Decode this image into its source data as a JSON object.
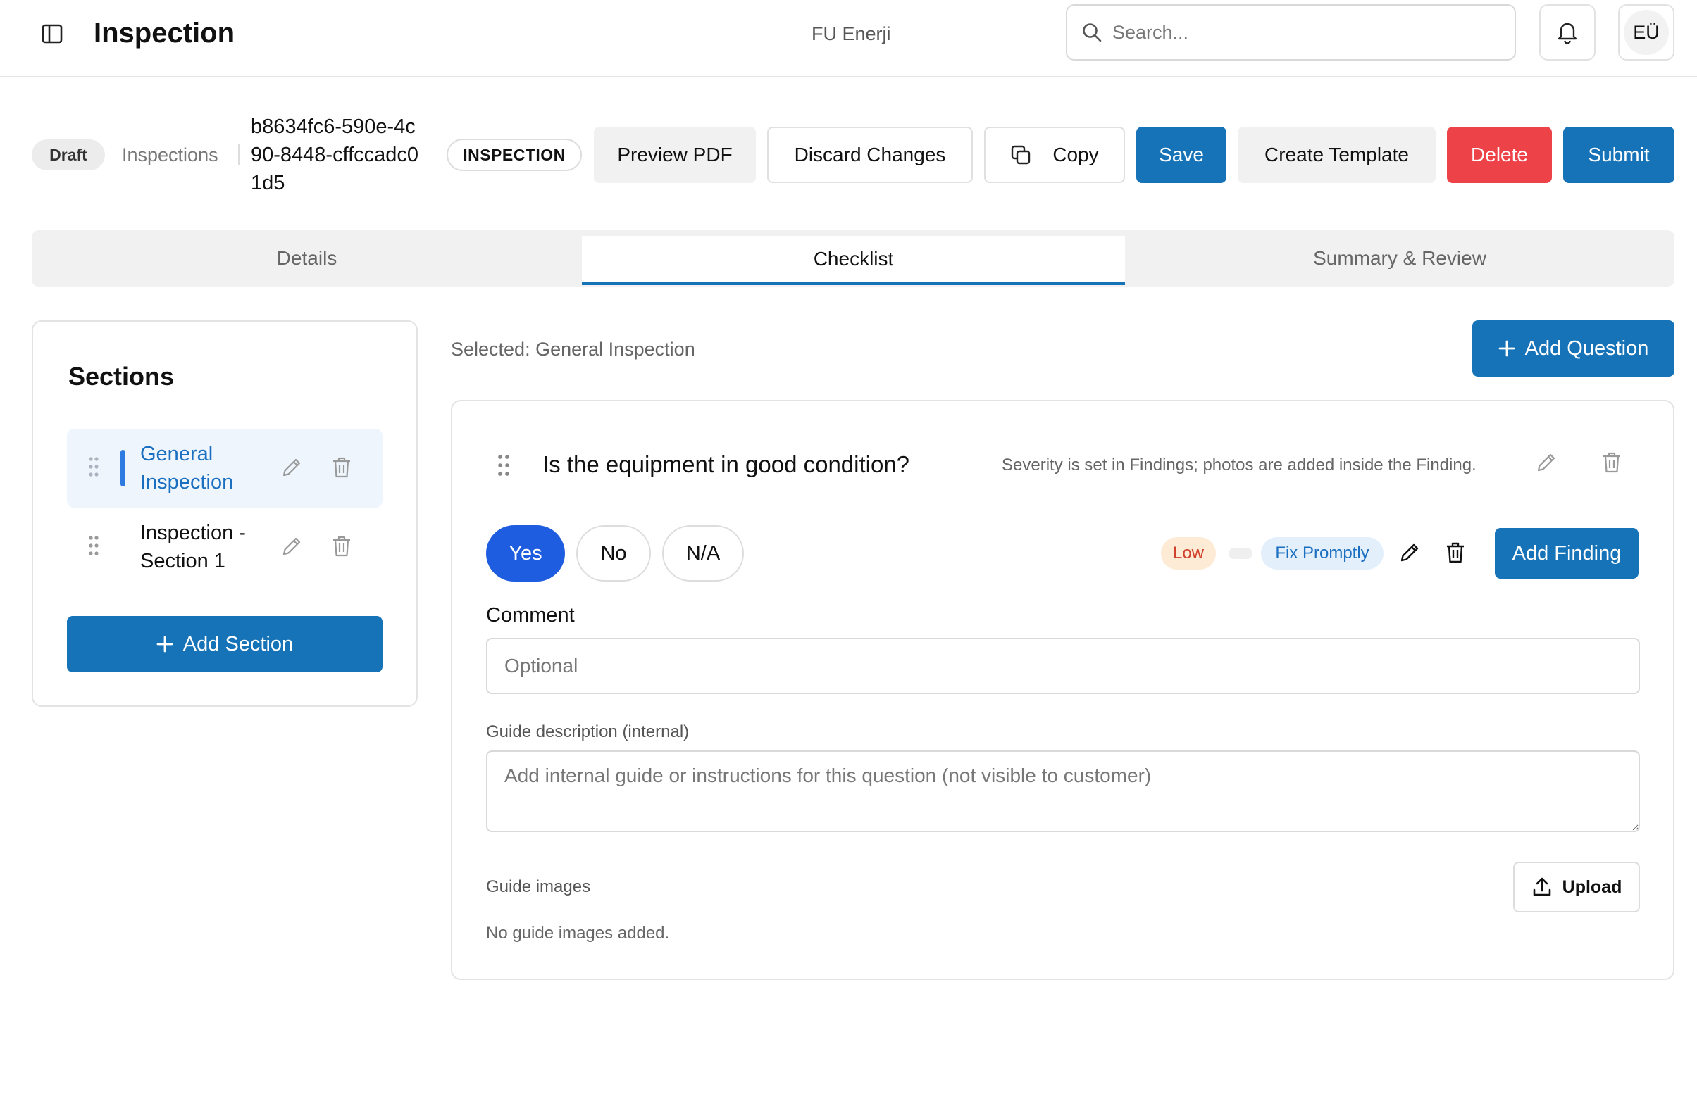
{
  "header": {
    "title": "Inspection",
    "org": "FU Enerji",
    "search_placeholder": "Search...",
    "avatar_initials": "EÜ"
  },
  "record": {
    "status": "Draft",
    "breadcrumb": "Inspections",
    "id": "b8634fc6-590e-4c90-8448-cffccadc01d5",
    "type": "INSPECTION"
  },
  "actions": {
    "preview_pdf": "Preview PDF",
    "discard": "Discard Changes",
    "copy": "Copy",
    "save": "Save",
    "create_template": "Create Template",
    "delete": "Delete",
    "submit": "Submit"
  },
  "tabs": [
    {
      "label": "Details",
      "active": false
    },
    {
      "label": "Checklist",
      "active": true
    },
    {
      "label": "Summary & Review",
      "active": false
    }
  ],
  "sections": {
    "title": "Sections",
    "items": [
      {
        "label": "General Inspection",
        "active": true
      },
      {
        "label": "Inspection - Section 1",
        "active": false
      }
    ],
    "add_label": "Add Section"
  },
  "main": {
    "selected_label": "Selected: General Inspection",
    "add_question": "Add Question"
  },
  "question": {
    "text": "Is the equipment in good condition?",
    "note": "Severity is set in Findings; photos are added inside the Finding.",
    "answers": [
      {
        "label": "Yes",
        "selected": true
      },
      {
        "label": "No",
        "selected": false
      },
      {
        "label": "N/A",
        "selected": false
      }
    ],
    "finding": {
      "severity": "Low",
      "action": "Fix Promptly",
      "add_label": "Add Finding"
    },
    "comment_label": "Comment",
    "comment_placeholder": "Optional",
    "guide_label": "Guide description (internal)",
    "guide_placeholder": "Add internal guide or instructions for this question (not visible to customer)",
    "images_label": "Guide images",
    "upload_label": "Upload",
    "no_images": "No guide images added."
  },
  "colors": {
    "primary": "#1673b8",
    "danger": "#ee4249",
    "selected_answer": "#1f5de0",
    "severity_low_bg": "#fdebd6",
    "severity_low_text": "#d0402a",
    "action_bg": "#e3effb",
    "action_text": "#1a6fc0"
  },
  "icons": [
    "sidebar-toggle-icon",
    "search-icon",
    "bell-icon",
    "copy-icon",
    "plus-icon",
    "drag-handle-icon",
    "pencil-icon",
    "trash-icon",
    "upload-icon"
  ]
}
